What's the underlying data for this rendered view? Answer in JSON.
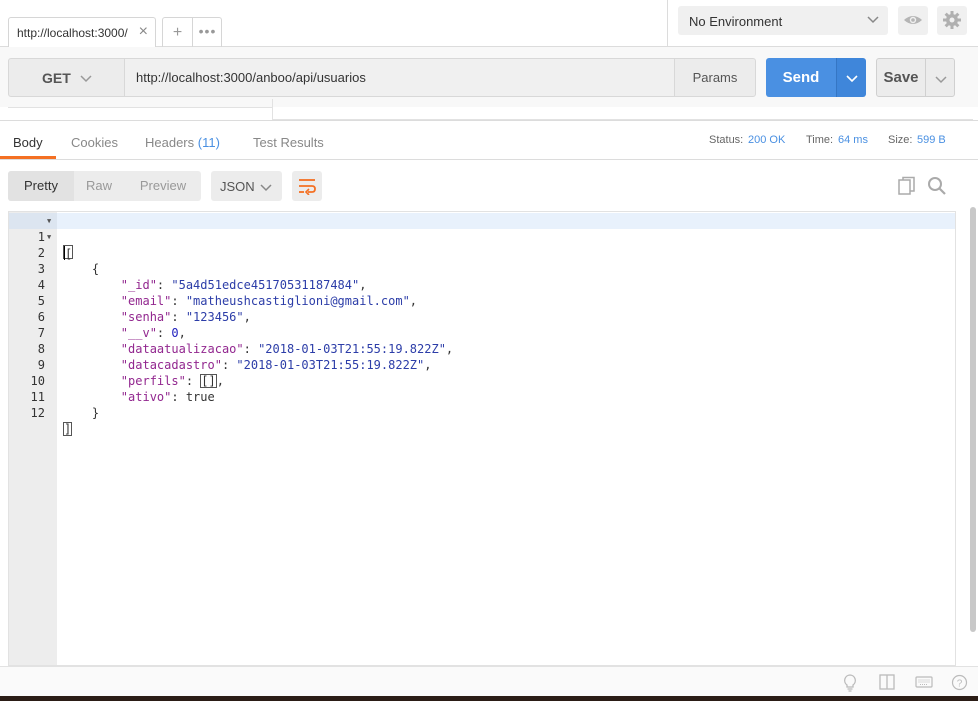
{
  "tabs": [
    {
      "title": "http://localhost:3000/",
      "close": "×"
    }
  ],
  "tab_actions": {
    "add": "+",
    "more": "•••"
  },
  "environment": {
    "selected": "No Environment"
  },
  "request": {
    "method": "GET",
    "url": "http://localhost:3000/anboo/api/usuarios",
    "params_label": "Params",
    "send_label": "Send",
    "save_label": "Save"
  },
  "response_tabs": {
    "body": "Body",
    "cookies": "Cookies",
    "headers": "Headers",
    "headers_count": "(11)",
    "tests": "Test Results"
  },
  "response_meta": {
    "status_label": "Status:",
    "status_value": "200 OK",
    "time_label": "Time:",
    "time_value": "64 ms",
    "size_label": "Size:",
    "size_value": "599 B"
  },
  "view_modes": {
    "pretty": "Pretty",
    "raw": "Raw",
    "preview": "Preview"
  },
  "format": "JSON",
  "body_json": {
    "line_numbers": [
      "1",
      "2",
      "3",
      "4",
      "5",
      "6",
      "7",
      "8",
      "9",
      "10",
      "11",
      "12"
    ],
    "lines": {
      "l2": "{",
      "id_key": "\"_id\"",
      "id_val": "\"5a4d51edce45170531187484\"",
      "email_key": "\"email\"",
      "email_val": "\"matheushcastiglioni@gmail.com\"",
      "senha_key": "\"senha\"",
      "senha_val": "\"123456\"",
      "v_key": "\"__v\"",
      "v_val": "0",
      "da_key": "\"dataatualizacao\"",
      "da_val": "\"2018-01-03T21:55:19.822Z\"",
      "dc_key": "\"datacadastro\"",
      "dc_val": "\"2018-01-03T21:55:19.822Z\"",
      "perfis_key": "\"perfils\"",
      "ativo_key": "\"ativo\"",
      "ativo_val": "true",
      "l11": "}"
    }
  },
  "colors": {
    "accent": "#f47023",
    "send": "#4a90e2",
    "json_key": "#92278f",
    "json_string": "#2c3da8"
  },
  "icons": [
    "close-icon",
    "add-tab-icon",
    "more-icon",
    "chevron-down-icon",
    "eye-icon",
    "gear-icon",
    "wrap-lines-icon",
    "copy-icon",
    "search-icon",
    "bulb-icon",
    "two-pane-icon",
    "keyboard-icon",
    "help-icon"
  ]
}
